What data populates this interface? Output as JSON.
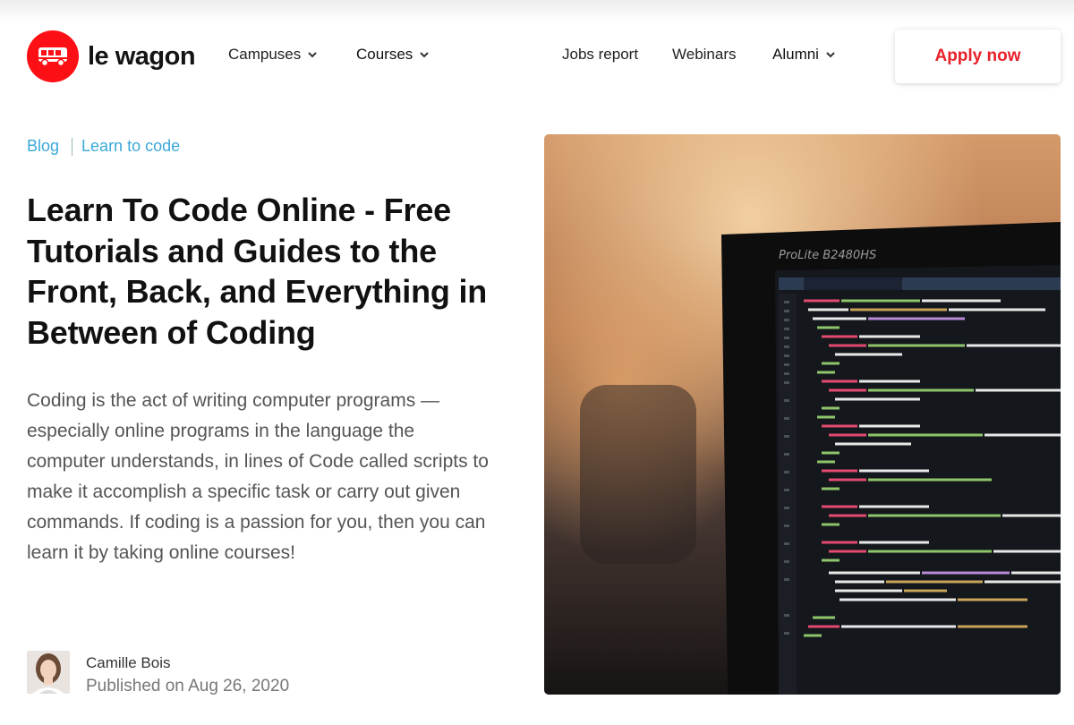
{
  "brand": {
    "name": "le wagon",
    "color": "#fd1015"
  },
  "nav": {
    "campuses": "Campuses",
    "courses": "Courses",
    "jobs_report": "Jobs report",
    "webinars": "Webinars",
    "alumni": "Alumni",
    "apply": "Apply now"
  },
  "breadcrumb": {
    "blog": "Blog",
    "category": "Learn to code"
  },
  "article": {
    "title": "Learn To Code Online - Free Tutorials and Guides to the Front, Back, and Everything in Between of Coding",
    "lead": "Coding is the act of writing computer programs — especially online programs in the language the computer understands, in lines of Code called scripts to make it accomplish a specific task or carry out given commands. If coding is a passion for you, then you can learn it by taking online courses!",
    "author": "Camille Bois",
    "published": "Published on Aug 26, 2020"
  },
  "hero": {
    "monitor_label": "ProLite B2480HS"
  },
  "colors": {
    "accent_link": "#3aa8d8",
    "apply_text": "#e8202a"
  }
}
